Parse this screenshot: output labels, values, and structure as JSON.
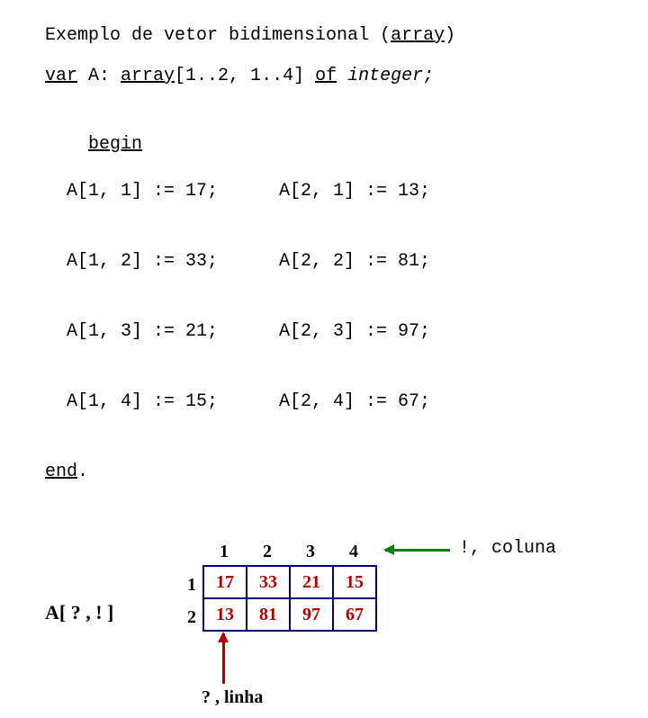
{
  "title": {
    "plain": "Exemplo de vetor bidimensional (",
    "underlined": "array",
    "tail": ")"
  },
  "declaration": {
    "var_kw": "var",
    "after_var": " A: ",
    "array_kw": "array",
    "bounds": "[1..2, 1..4] ",
    "of_kw": "of",
    "type_part": " integer;"
  },
  "code": {
    "begin_kw": "begin",
    "end_kw": "end",
    "period": ".",
    "rows": [
      {
        "left": "  A[1, 1] := 17;",
        "right": "A[2, 1] := 13;"
      },
      {
        "left": "  A[1, 2] := 33;",
        "right": "A[2, 2] := 81;"
      },
      {
        "left": "  A[1, 3] := 21;",
        "right": "A[2, 3] := 97;"
      },
      {
        "left": "  A[1, 4] := 15;",
        "right": "A[2, 4] := 67;"
      }
    ]
  },
  "array_label": "A[ ? , ! ]",
  "col_headers": [
    "1",
    "2",
    "3",
    "4"
  ],
  "row_headers": [
    "1",
    "2"
  ],
  "chart_data": {
    "type": "table",
    "rows": 2,
    "cols": 4,
    "col_headers": [
      "1",
      "2",
      "3",
      "4"
    ],
    "row_headers": [
      "1",
      "2"
    ],
    "cells": [
      [
        "17",
        "33",
        "21",
        "15"
      ],
      [
        "13",
        "81",
        "97",
        "67"
      ]
    ]
  },
  "legends": {
    "col": "!, coluna",
    "row": "? , linha"
  }
}
